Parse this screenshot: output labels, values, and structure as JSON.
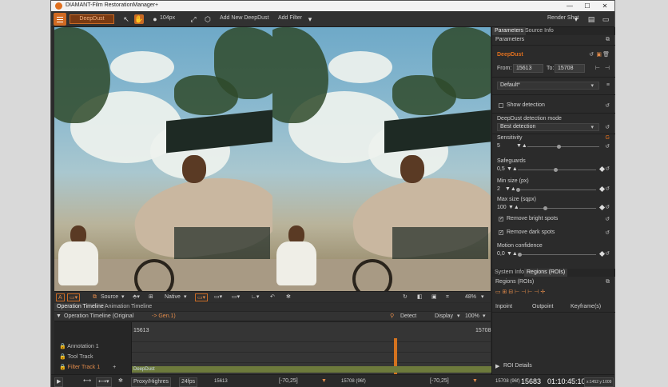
{
  "window": {
    "title": "DIAMANT-Film RestorationManager+"
  },
  "toolbar": {
    "tool_name": "DeepDust",
    "brush_size": "104px",
    "add_new_label": "Add New DeepDust",
    "add_filter_label": "Add Filter",
    "render_shot_label": "Render Shot"
  },
  "viewer_bar": {
    "source_label": "Source",
    "scale_label": "Native",
    "zoom_label": "48%"
  },
  "side": {
    "tabs": [
      "Parameters",
      "Source Info"
    ],
    "section_title": "Parameters",
    "filter_name": "DeepDust",
    "from_label": "From:",
    "from_value": "15613",
    "to_label": "To:",
    "to_value": "15708",
    "preset_value": "Default*",
    "show_detection_label": "Show detection",
    "mode_label": "DeepDust detection mode",
    "mode_value": "Best detection",
    "sensitivity_label": "Sensitivity",
    "sensitivity_value": "5",
    "sensitivity_g": "G",
    "safeguards_label": "Safeguards",
    "safeguards_value": "0,5",
    "minsize_label": "Min size (px)",
    "minsize_value": "2",
    "maxsize_label": "Max size (sqpx)",
    "maxsize_value": "100",
    "bright_label": "Remove bright spots",
    "dark_label": "Remove dark spots",
    "motion_label": "Motion confidence",
    "motion_value": "0,0",
    "lower_tabs": [
      "System Info",
      "Regions (ROIs)"
    ],
    "regions_title": "Regions (ROIs)",
    "col_inpoint": "Inpoint",
    "col_outpoint": "Outpoint",
    "col_keyframes": "Keyframe(s)",
    "roi_details": "ROI Details"
  },
  "timeline": {
    "tabs": [
      "Operation Timeline",
      "Animation Timeline"
    ],
    "header_label": "Operation Timeline (Original",
    "header_gen": "-> Gen.1)",
    "detect_label": "Detect",
    "display_label": "Display",
    "zoom_value": "100%",
    "start_frame": "15613",
    "end_frame": "15708",
    "tracks": [
      "Annotation 1",
      "Tool Track",
      "Filter Track 1"
    ],
    "filter_clip_label": "DeepDust"
  },
  "bottom": {
    "proxy_label": "Proxy/Highres",
    "fps_label": "24fps",
    "in_frame": "15613",
    "range_left": "[-70,25]",
    "mid_frame": "15708 (96f)",
    "range_right": "[-70,25]",
    "out_frame": "15708 (96f)",
    "current_frame": "15683",
    "timecode": "01:10:45:10",
    "coords": "x:1452 y:1009"
  }
}
